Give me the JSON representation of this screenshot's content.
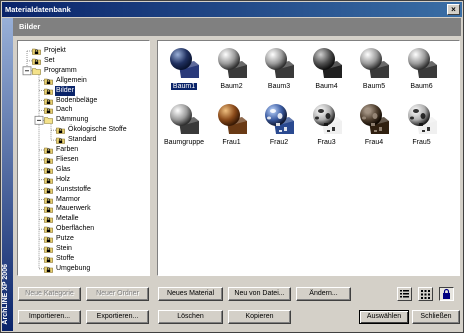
{
  "window": {
    "title": "Materialdatenbank",
    "side_label": "ArchLINE XP 2006"
  },
  "header": {
    "title": "Bilder"
  },
  "tree": [
    {
      "label": "Projekt",
      "level": 1,
      "kind": "lock",
      "selected": false
    },
    {
      "label": "Set",
      "level": 1,
      "kind": "lock",
      "selected": false
    },
    {
      "label": "Programm",
      "level": 1,
      "kind": "folder",
      "selected": false
    },
    {
      "label": "Allgemein",
      "level": 2,
      "kind": "lock",
      "selected": false
    },
    {
      "label": "Bilder",
      "level": 2,
      "kind": "lock",
      "selected": true
    },
    {
      "label": "Bodenbeläge",
      "level": 2,
      "kind": "lock",
      "selected": false
    },
    {
      "label": "Dach",
      "level": 2,
      "kind": "lock",
      "selected": false
    },
    {
      "label": "Dämmung",
      "level": 2,
      "kind": "folder",
      "selected": false
    },
    {
      "label": "Ökologische Stoffe",
      "level": 3,
      "kind": "lock",
      "selected": false
    },
    {
      "label": "Standard",
      "level": 3,
      "kind": "lock",
      "selected": false
    },
    {
      "label": "Farben",
      "level": 2,
      "kind": "lock",
      "selected": false
    },
    {
      "label": "Fliesen",
      "level": 2,
      "kind": "lock",
      "selected": false
    },
    {
      "label": "Glas",
      "level": 2,
      "kind": "lock",
      "selected": false
    },
    {
      "label": "Holz",
      "level": 2,
      "kind": "lock",
      "selected": false
    },
    {
      "label": "Kunststoffe",
      "level": 2,
      "kind": "lock",
      "selected": false
    },
    {
      "label": "Marmor",
      "level": 2,
      "kind": "lock",
      "selected": false
    },
    {
      "label": "Mauerwerk",
      "level": 2,
      "kind": "lock",
      "selected": false
    },
    {
      "label": "Metalle",
      "level": 2,
      "kind": "lock",
      "selected": false
    },
    {
      "label": "Oberflächen",
      "level": 2,
      "kind": "lock",
      "selected": false
    },
    {
      "label": "Putze",
      "level": 2,
      "kind": "lock",
      "selected": false
    },
    {
      "label": "Stein",
      "level": 2,
      "kind": "lock",
      "selected": false
    },
    {
      "label": "Stoffe",
      "level": 2,
      "kind": "lock",
      "selected": false
    },
    {
      "label": "Umgebung",
      "level": 2,
      "kind": "lock",
      "selected": false
    }
  ],
  "materials": [
    {
      "label": "Baum1",
      "style": "dark-blue",
      "selected": true
    },
    {
      "label": "Baum2",
      "style": "gray",
      "selected": false
    },
    {
      "label": "Baum3",
      "style": "gray",
      "selected": false
    },
    {
      "label": "Baum4",
      "style": "dark",
      "selected": false
    },
    {
      "label": "Baum5",
      "style": "gray",
      "selected": false
    },
    {
      "label": "Baum6",
      "style": "gray",
      "selected": false
    },
    {
      "label": "Baumgruppe",
      "style": "gray",
      "selected": false
    },
    {
      "label": "Frau1",
      "style": "brown",
      "selected": false
    },
    {
      "label": "Frau2",
      "style": "blue-pattern",
      "selected": false
    },
    {
      "label": "Frau3",
      "style": "cow",
      "selected": false
    },
    {
      "label": "Frau4",
      "style": "dark-pattern",
      "selected": false
    },
    {
      "label": "Frau5",
      "style": "cow",
      "selected": false
    }
  ],
  "buttons": {
    "new_category": "Neue Kategorie",
    "new_folder": "Neuer Ordner",
    "new_material": "Neues Material",
    "from_file": "Neu von Datei...",
    "change": "Ändern...",
    "import": "Importieren...",
    "export": "Exportieren...",
    "delete": "Löschen",
    "copy": "Kopieren",
    "select": "Auswählen",
    "close": "Schließen"
  },
  "colors": {
    "title_bar": "#0a246a",
    "selection": "#0a246a",
    "header_bar": "#808080",
    "face": "#d4d0c8"
  }
}
